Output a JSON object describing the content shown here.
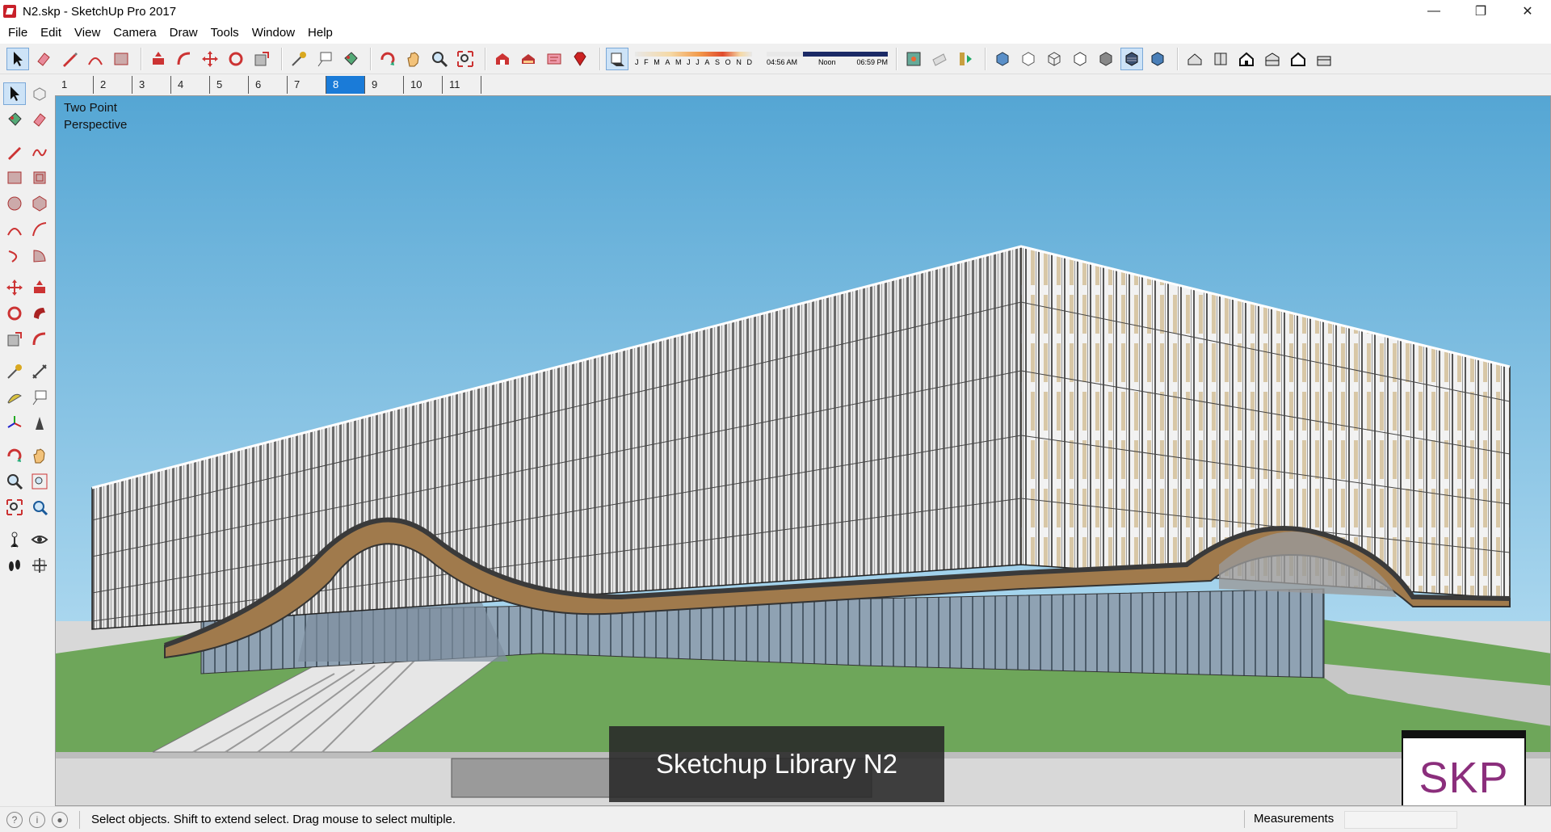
{
  "window": {
    "title": "N2.skp - SketchUp Pro 2017",
    "controls": [
      "—",
      "❐",
      "✕"
    ]
  },
  "menu": [
    "File",
    "Edit",
    "View",
    "Camera",
    "Draw",
    "Tools",
    "Window",
    "Help"
  ],
  "shadow_settings": {
    "months": [
      "J",
      "F",
      "M",
      "A",
      "M",
      "J",
      "J",
      "A",
      "S",
      "O",
      "N",
      "D"
    ],
    "time_start": "04:56 AM",
    "time_mid": "Noon",
    "time_end": "06:59 PM"
  },
  "scene_tabs": {
    "items": [
      "1",
      "2",
      "3",
      "4",
      "5",
      "6",
      "7",
      "8",
      "9",
      "10",
      "11"
    ],
    "active": "8"
  },
  "viewport": {
    "camera_label": "Two Point\nPerspective",
    "caption": "Sketchup Library N2",
    "logo_text": "SKP"
  },
  "statusbar": {
    "message": "Select objects. Shift to extend select. Drag mouse to select multiple.",
    "measurements_label": "Measurements",
    "measurements_value": ""
  },
  "colors": {
    "sky_top": "#55a6d4",
    "sky_bottom": "#a9d6ee",
    "grass": "#6ea65a",
    "active_tab": "#1a7bd8",
    "wood_soffit": "#a07a4c"
  }
}
